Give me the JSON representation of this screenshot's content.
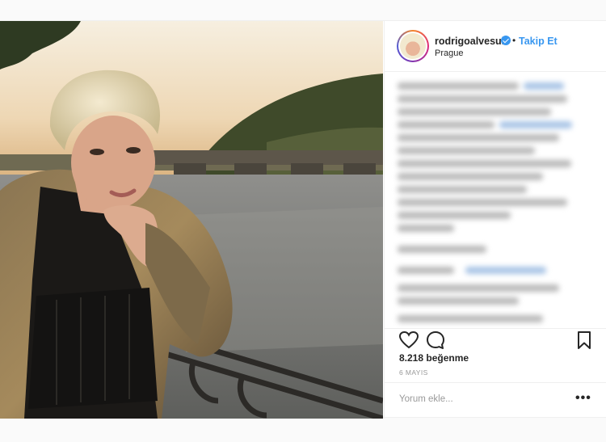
{
  "post": {
    "author": {
      "username": "rodrigoalvesuk",
      "verified": true,
      "follow_label": "Takip Et",
      "separator": "•",
      "location": "Prague"
    },
    "image": {
      "subject": "man with platinum hair in a gold jacket leaning on a railing",
      "background": "river with a stone bridge and hill at sunset"
    },
    "caption_blurred": true,
    "actions": {
      "like_icon": "heart-icon",
      "comment_icon": "comment-icon",
      "save_icon": "bookmark-icon"
    },
    "likes_text": "8.218 beğenme",
    "date_text": "6 MAYIS",
    "comment_placeholder": "Yorum ekle...",
    "more_label": "•••"
  },
  "colors": {
    "accent": "#3897f0",
    "text": "#262626",
    "muted": "#999999",
    "border": "#efefef"
  }
}
